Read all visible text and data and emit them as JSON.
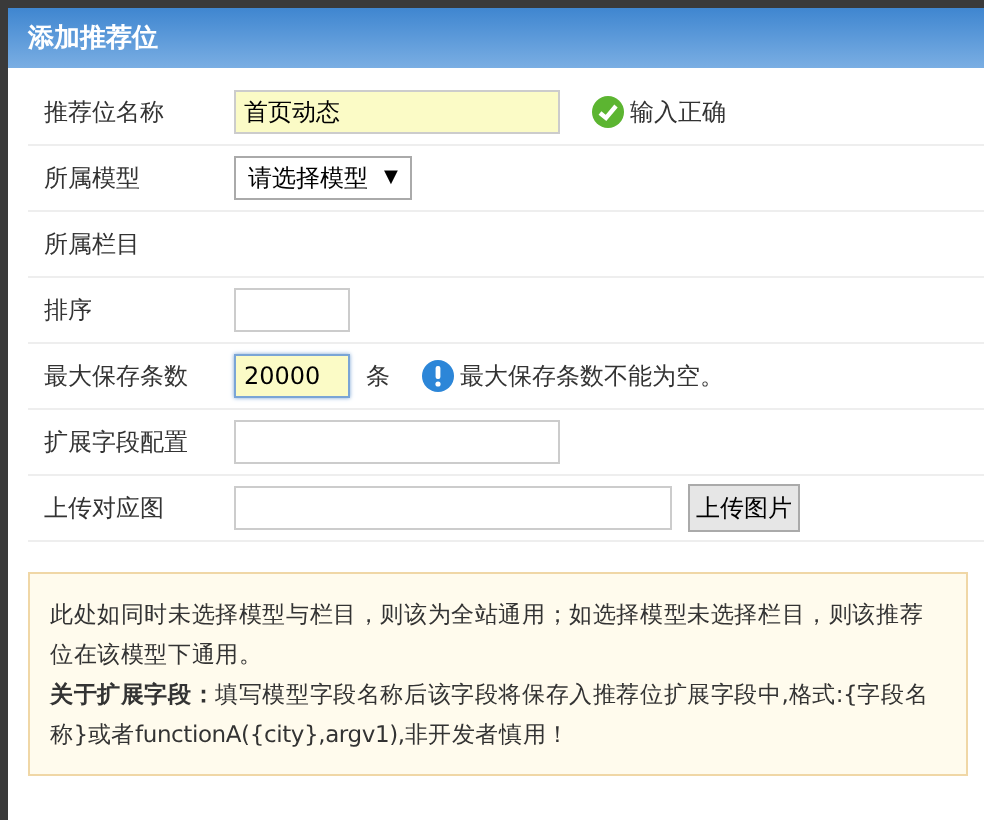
{
  "dialog": {
    "title": "添加推荐位"
  },
  "rows": [
    {
      "label": "推荐位名称",
      "kind": "text",
      "value": "首页动态",
      "highlighted": true,
      "message": {
        "kind": "ok",
        "text": "输入正确"
      }
    },
    {
      "label": "所属模型",
      "kind": "select",
      "value": "请选择模型",
      "caret": "▼"
    },
    {
      "label": "所属栏目",
      "kind": "static"
    },
    {
      "label": "排序",
      "kind": "text",
      "highlighted": false
    },
    {
      "label": "最大保存条数",
      "kind": "text",
      "value": "20000",
      "highlighted": true,
      "focused": true,
      "unit": "条",
      "message": {
        "kind": "info",
        "text": "最大保存条数不能为空。"
      }
    },
    {
      "label": "扩展字段配置",
      "kind": "text",
      "highlighted": false
    },
    {
      "label": "上传对应图",
      "kind": "upload",
      "button": "上传图片"
    }
  ],
  "note": {
    "paragraphs": [
      "此处如同时未选择模型与栏目，则该为全站通用；如选择模型未选择栏目，则该推荐位在该模型下通用。",
      "**关于扩展字段：**填写模型字段名称后该字段将保存入推荐位扩展字段中,格式:{字段名称}或者functionA({city},argv1),非开发者慎用！"
    ]
  }
}
